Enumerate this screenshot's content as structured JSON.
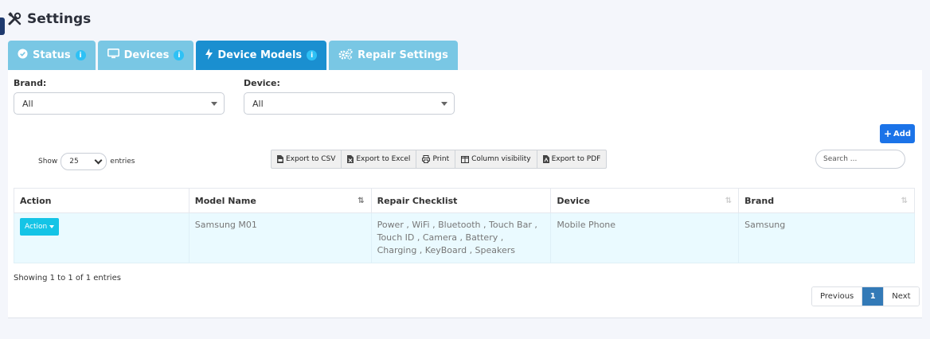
{
  "header": {
    "title": "Settings",
    "icon": "tools-icon"
  },
  "tabs": [
    {
      "label": "Status",
      "icon": "check-circle-icon",
      "info": true,
      "active": false
    },
    {
      "label": "Devices",
      "icon": "monitor-icon",
      "info": true,
      "active": false
    },
    {
      "label": "Device Models",
      "icon": "bolt-icon",
      "info": true,
      "active": true
    },
    {
      "label": "Repair Settings",
      "icon": "gears-icon",
      "info": false,
      "active": false
    }
  ],
  "filters": {
    "brand": {
      "label": "Brand:",
      "value": "All"
    },
    "device": {
      "label": "Device:",
      "value": "All"
    }
  },
  "toolbar": {
    "add_label": "Add",
    "show_label": "Show",
    "entries_label": "entries",
    "page_length": "25",
    "search_placeholder": "Search ...",
    "exports": [
      {
        "label": "Export to CSV",
        "icon": "file-csv-icon"
      },
      {
        "label": "Export to Excel",
        "icon": "file-excel-icon"
      },
      {
        "label": "Print",
        "icon": "print-icon"
      },
      {
        "label": "Column visibility",
        "icon": "columns-icon"
      },
      {
        "label": "Export to PDF",
        "icon": "file-pdf-icon"
      }
    ]
  },
  "table": {
    "columns": [
      "Action",
      "Model Name",
      "Repair Checklist",
      "Device",
      "Brand"
    ],
    "rows": [
      {
        "action_label": "Action",
        "model_name": "Samsung M01",
        "repair_checklist": "Power , WiFi , Bluetooth , Touch Bar , Touch ID , Camera , Battery , Charging , KeyBoard , Speakers",
        "device": "Mobile Phone",
        "brand": "Samsung"
      }
    ]
  },
  "footer": {
    "info": "Showing 1 to 1 of 1 entries",
    "previous": "Previous",
    "current_page": "1",
    "next": "Next"
  },
  "colors": {
    "tab": "#79c7e4",
    "tab_active": "#1a8fd0",
    "add_button": "#1b73e8",
    "action_button": "#14c4e6",
    "pager_active": "#337ab7",
    "row_highlight": "#eafaff"
  }
}
